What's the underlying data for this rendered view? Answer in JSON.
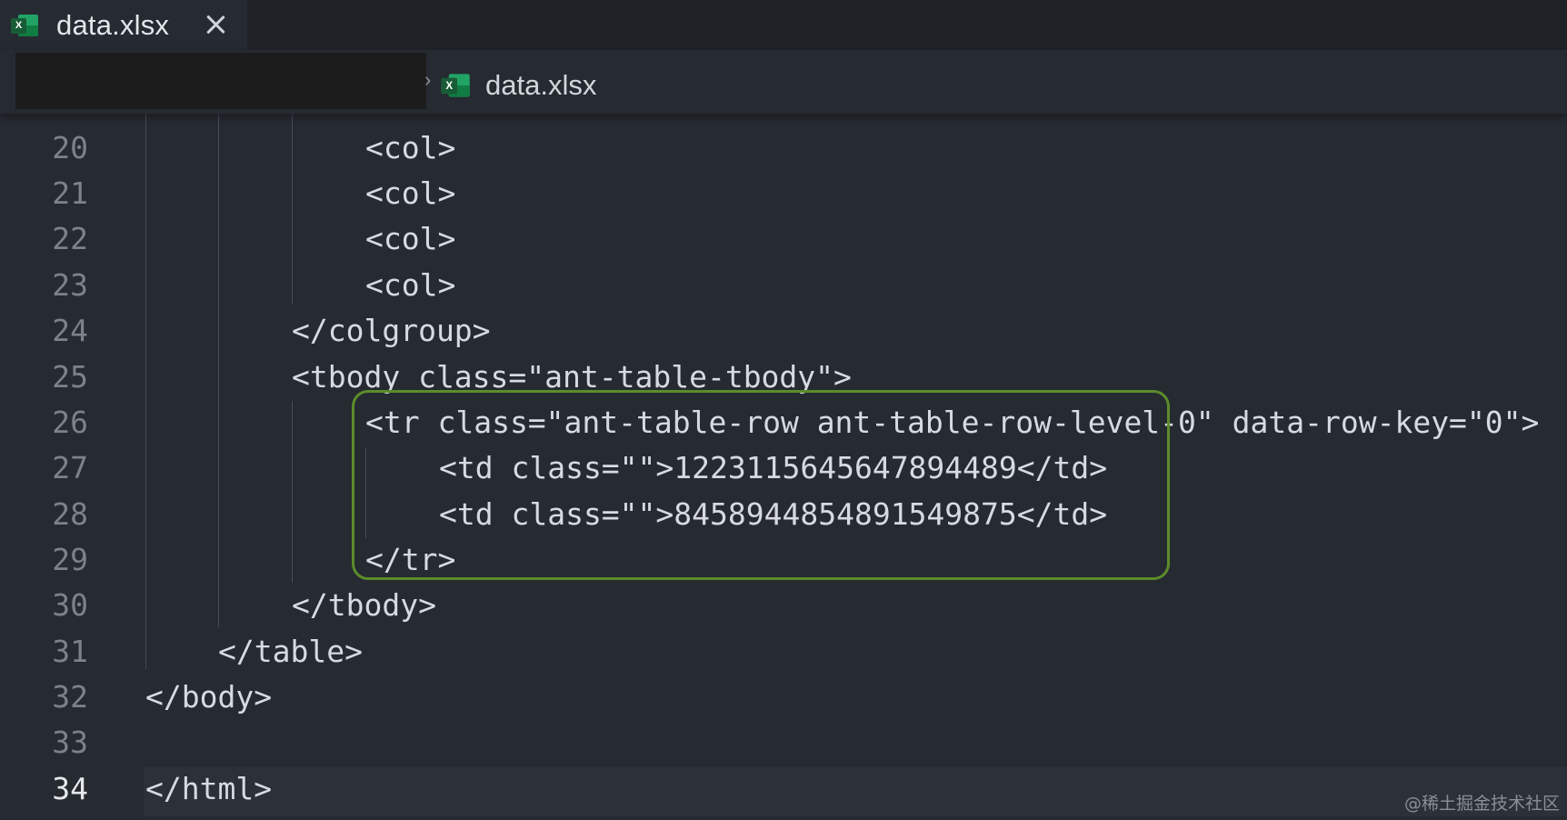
{
  "tab": {
    "title": "data.xlsx",
    "icon": "excel-file-icon"
  },
  "breadcrumb": {
    "file": "data.xlsx",
    "separator": "›"
  },
  "editor": {
    "current_line": "34",
    "lines": [
      {
        "num": "20",
        "text": "<col>"
      },
      {
        "num": "21",
        "text": "<col>"
      },
      {
        "num": "22",
        "text": "<col>"
      },
      {
        "num": "23",
        "text": "<col>"
      },
      {
        "num": "24",
        "text": "</colgroup>"
      },
      {
        "num": "25",
        "text": "<tbody class=\"ant-table-tbody\">"
      },
      {
        "num": "26",
        "text": "<tr class=\"ant-table-row ant-table-row-level-0\" data-row-key=\"0\">"
      },
      {
        "num": "27",
        "text": "<td class=\"\">1223115645647894489</td>"
      },
      {
        "num": "28",
        "text": "<td class=\"\">8458944854891549875</td>"
      },
      {
        "num": "29",
        "text": "</tr>"
      },
      {
        "num": "30",
        "text": "</tbody>"
      },
      {
        "num": "31",
        "text": "</table>"
      },
      {
        "num": "32",
        "text": "</body>"
      },
      {
        "num": "33",
        "text": ""
      },
      {
        "num": "34",
        "text": "</html>"
      }
    ]
  },
  "colors": {
    "highlight_border": "#5b8c2a",
    "background": "#262a31"
  },
  "watermark": "@稀土掘金技术社区"
}
